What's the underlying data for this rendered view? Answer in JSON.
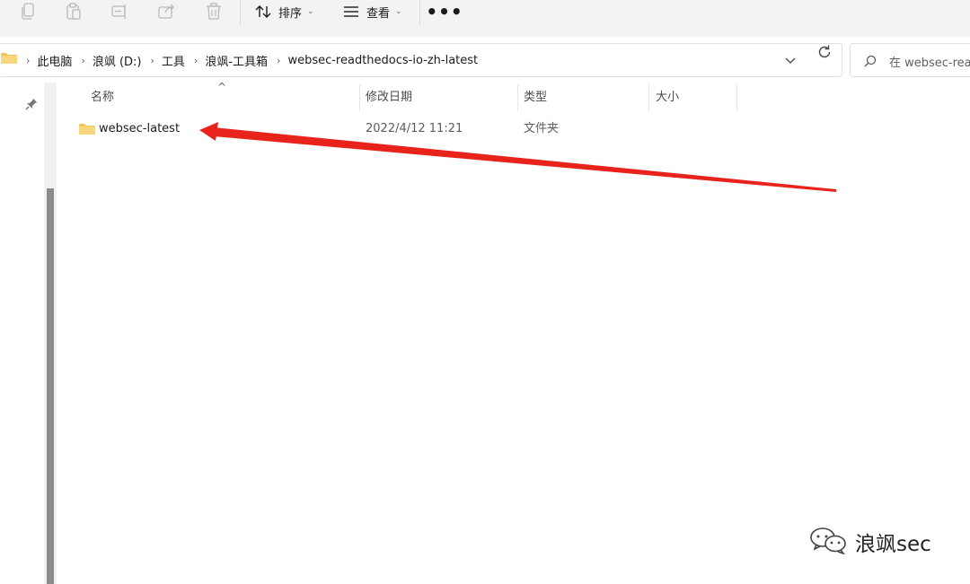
{
  "toolbar": {
    "icons": [
      "copy-icon",
      "paste-icon",
      "rename-icon",
      "share-icon",
      "delete-icon"
    ],
    "sort_label": "排序",
    "view_label": "查看",
    "more_label": "•••"
  },
  "address": {
    "crumbs": [
      "此电脑",
      "浪飒 (D:)",
      "工具",
      "浪飒-工具箱",
      "websec-readthedocs-io-zh-latest"
    ]
  },
  "search": {
    "placeholder": "在 websec-read"
  },
  "columns": {
    "name": "名称",
    "modified": "修改日期",
    "type": "类型",
    "size": "大小"
  },
  "files": [
    {
      "name": "websec-latest",
      "modified": "2022/4/12 11:21",
      "type": "文件夹",
      "size": ""
    }
  ],
  "annotation": {
    "arrow_color": "#e8231b"
  },
  "watermark": {
    "text": "浪飒sec"
  },
  "colors": {
    "folder": "#f2c55c",
    "accent": "#0067c0"
  }
}
